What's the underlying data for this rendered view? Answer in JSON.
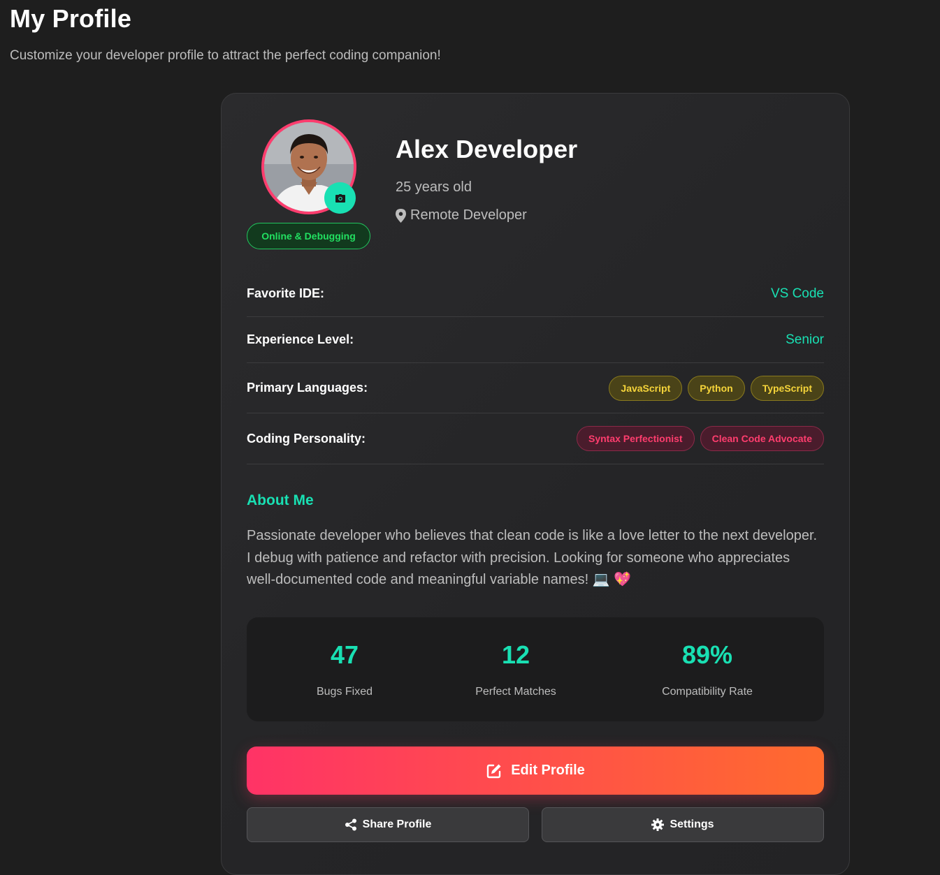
{
  "header": {
    "title": "My Profile",
    "subtitle": "Customize your developer profile to attract the perfect coding companion!"
  },
  "profile": {
    "name": "Alex Developer",
    "age": "25 years old",
    "location": "Remote Developer",
    "status": "Online & Debugging"
  },
  "details": {
    "ide_label": "Favorite IDE:",
    "ide_value": "VS Code",
    "experience_label": "Experience Level:",
    "experience_value": "Senior",
    "languages_label": "Primary Languages:",
    "languages": [
      "JavaScript",
      "Python",
      "TypeScript"
    ],
    "personality_label": "Coding Personality:",
    "personality": [
      "Syntax Perfectionist",
      "Clean Code Advocate"
    ]
  },
  "about": {
    "title": "About Me",
    "text": "Passionate developer who believes that clean code is like a love letter to the next developer. I debug with patience and refactor with precision. Looking for someone who appreciates well-documented code and meaningful variable names! 💻 💖"
  },
  "stats": [
    {
      "value": "47",
      "label": "Bugs Fixed"
    },
    {
      "value": "12",
      "label": "Perfect Matches"
    },
    {
      "value": "89%",
      "label": "Compatibility Rate"
    }
  ],
  "actions": {
    "edit": "Edit Profile",
    "share": "Share Profile",
    "settings": "Settings"
  },
  "colors": {
    "accent": "#19e0b3",
    "primary": "#ff3366",
    "status": "#22c55e"
  }
}
